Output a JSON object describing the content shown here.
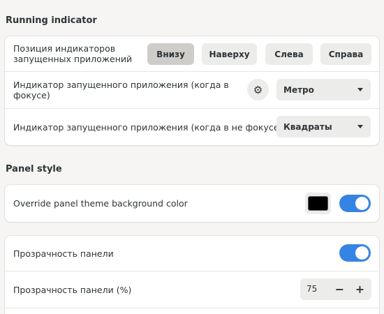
{
  "running_indicator": {
    "title": "Running indicator",
    "position_row": {
      "label_line1": "Позиция индикаторов",
      "label_line2": "запущенных приложений",
      "buttons": [
        "Внизу",
        "Наверху",
        "Слева",
        "Справа"
      ],
      "selected": "Внизу"
    },
    "focused_row": {
      "label_line1": "Индикатор запущенного приложения (когда в",
      "label_line2": "фокусе)",
      "settings_icon": "gear-icon",
      "value": "Метро"
    },
    "unfocused_row": {
      "label": "Индикатор запущенного приложения (когда в не фокусе)",
      "value": "Квадраты"
    }
  },
  "panel_style": {
    "title": "Panel style",
    "override_row": {
      "label": "Override panel theme background color",
      "color": "#000000",
      "enabled": true
    },
    "transparency_row": {
      "label": "Прозрачность панели",
      "enabled": true
    },
    "transparency_percent_row": {
      "label": "Прозрачность панели (%)",
      "value": "75",
      "decrement": "−",
      "increment": "+"
    }
  },
  "colors": {
    "accent": "#3584e4"
  }
}
